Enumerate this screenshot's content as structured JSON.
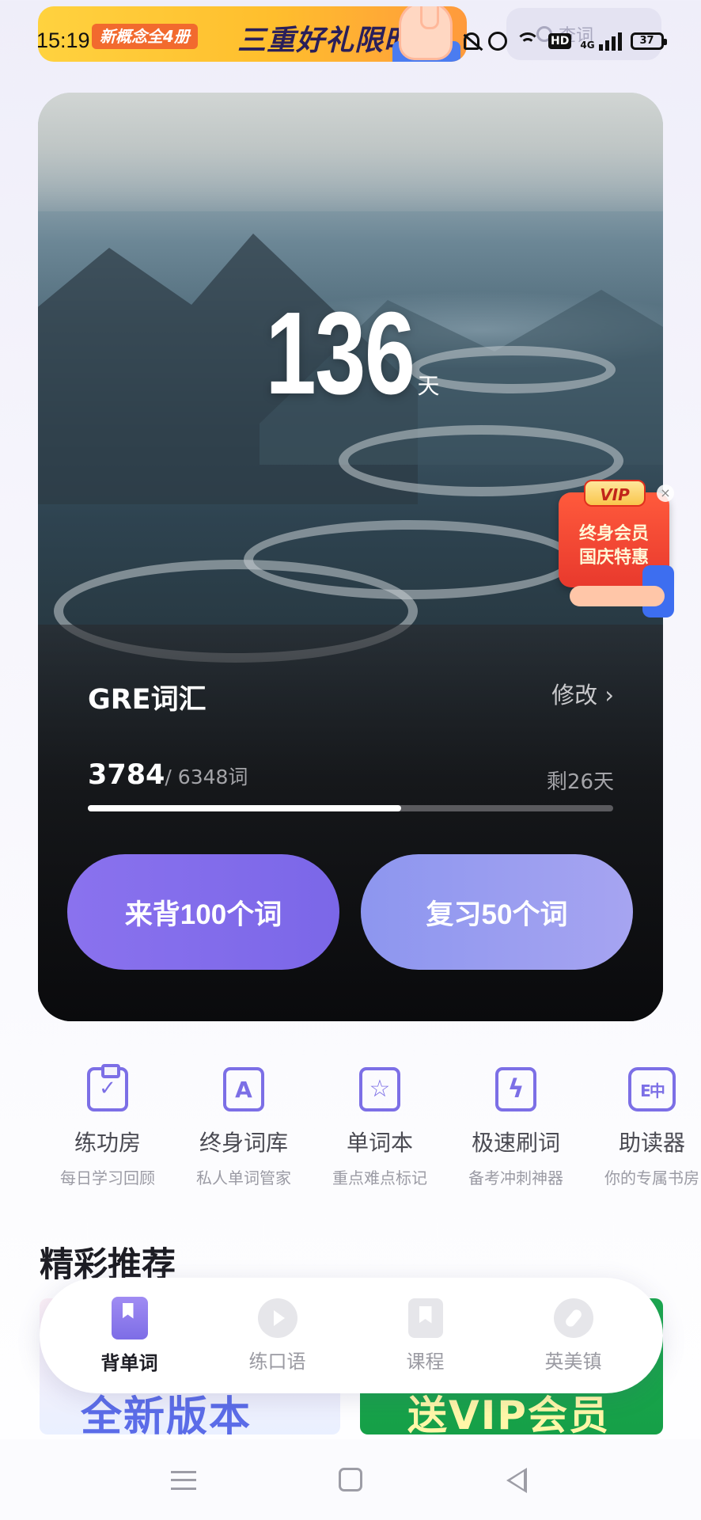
{
  "status_bar": {
    "time": "15:19",
    "network": "4G",
    "hd_label": "HD",
    "battery": "37"
  },
  "promo": {
    "tag": "新概念全4册",
    "headline": "三重好礼限时送"
  },
  "search": {
    "label": "查词"
  },
  "hero": {
    "days_number": "136",
    "days_unit": "天",
    "book_name": "GRE词汇",
    "edit_label": "修改 ›",
    "learned_count": "3784",
    "total_label": "/ 6348词",
    "days_left": "剩26天",
    "progress_fraction": 0.596,
    "learn_button": "来背100个词",
    "review_button": "复习50个词"
  },
  "vip_float": {
    "badge": "VIP",
    "line1": "终身会员",
    "line2": "国庆特惠"
  },
  "tools": [
    {
      "title": "练功房",
      "subtitle": "每日学习回顾",
      "icon": "clipboard-check-icon"
    },
    {
      "title": "终身词库",
      "subtitle": "私人单词管家",
      "icon": "word-cards-icon"
    },
    {
      "title": "单词本",
      "subtitle": "重点难点标记",
      "icon": "star-card-icon"
    },
    {
      "title": "极速刷词",
      "subtitle": "备考冲刺神器",
      "icon": "bolt-card-icon"
    },
    {
      "title": "助读器",
      "subtitle": "你的专属书房",
      "icon": "reader-icon"
    }
  ],
  "section": {
    "title": "精彩推荐"
  },
  "banners": {
    "left_text": "全新版本",
    "right_text": "送VIP会员"
  },
  "bottom_nav": [
    {
      "label": "背单词",
      "icon": "book-icon",
      "active": true
    },
    {
      "label": "练口语",
      "icon": "play-icon",
      "active": false
    },
    {
      "label": "课程",
      "icon": "course-icon",
      "active": false
    },
    {
      "label": "英美镇",
      "icon": "compass-icon",
      "active": false
    }
  ],
  "colors": {
    "accent": "#7c6fe6",
    "learn_button": "#8a72ee",
    "review_button": "#a6a4f1",
    "vip_red": "#e8392d"
  }
}
